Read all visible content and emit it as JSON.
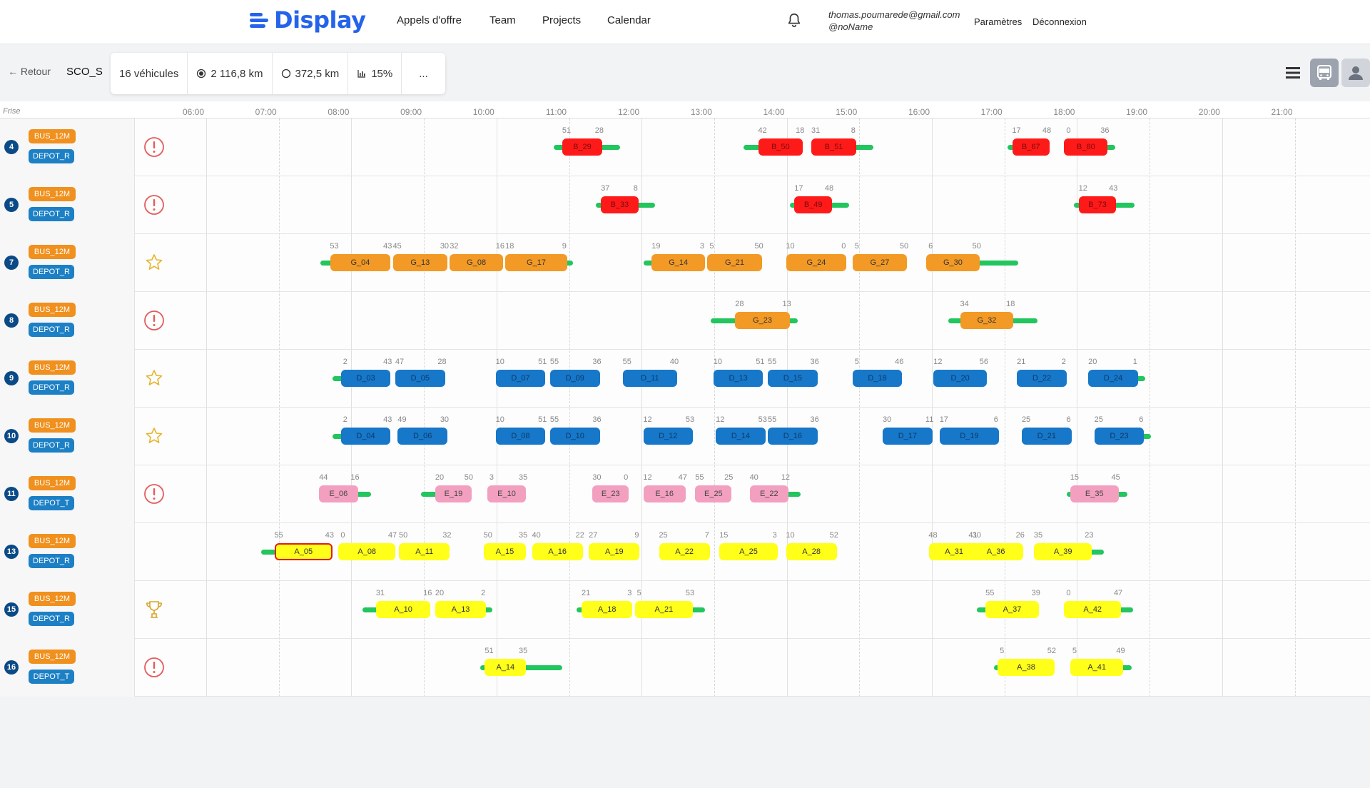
{
  "app": {
    "logo": "Display",
    "colors": {
      "brand": "#2563eb",
      "bus": "#f0901e",
      "depot": "#1d80c5",
      "green": "#22c55e",
      "vnum": "#0b4a86"
    }
  },
  "nav": {
    "links": [
      "Appels d'offre",
      "Team",
      "Projects",
      "Calendar"
    ],
    "user_email": "thomas.poumarede@gmail.com",
    "user_handle": "@noName",
    "settings": "Paramètres",
    "logout": "Déconnexion",
    "bell_icon": "bell-icon"
  },
  "toolbar": {
    "back": "← Retour",
    "line": "SCO_S",
    "vehicles": "16 véhicules",
    "km_loaded": "2 116,8 km",
    "km_empty": "372,5 km",
    "ratio": "15%",
    "more": "...",
    "view_icons": [
      "list-icon",
      "bus-icon",
      "person-icon"
    ]
  },
  "timeline": {
    "frise": "Frise",
    "hours": [
      "06:00",
      "07:00",
      "08:00",
      "09:00",
      "10:00",
      "11:00",
      "12:00",
      "13:00",
      "14:00",
      "15:00",
      "16:00",
      "17:00",
      "18:00",
      "19:00",
      "20:00",
      "21:00"
    ],
    "rows": [
      {
        "num": "4",
        "bus": "BUS_12M",
        "depot": "DEPOT_R",
        "status": "alert",
        "blocks": [
          {
            "label": "B_29",
            "c": "red",
            "s": "11:05",
            "e": "11:38",
            "n1": "51",
            "n2": "28",
            "pre": "10:58",
            "post": "11:53"
          },
          {
            "label": "B_50",
            "c": "red",
            "s": "13:47",
            "e": "14:24",
            "n1": "42",
            "n2": "18",
            "pre": "13:35",
            "post": null
          },
          {
            "label": "B_51",
            "c": "red",
            "s": "14:31",
            "e": "15:08",
            "n1": "31",
            "n2": "8",
            "pre": null,
            "post": "15:22"
          },
          {
            "label": "B_67",
            "c": "red",
            "s": "17:17",
            "e": "17:48",
            "n1": "17",
            "n2": "48",
            "pre": "17:13",
            "post": null
          },
          {
            "label": "B_80",
            "c": "red",
            "s": "18:00",
            "e": "18:36",
            "n1": "0",
            "n2": "36",
            "pre": null,
            "post": "18:42"
          }
        ]
      },
      {
        "num": "5",
        "bus": "BUS_12M",
        "depot": "DEPOT_R",
        "status": "alert",
        "blocks": [
          {
            "label": "B_33",
            "c": "red",
            "s": "11:37",
            "e": "12:08",
            "n1": "37",
            "n2": "8",
            "pre": "11:33",
            "post": "12:22"
          },
          {
            "label": "B_49",
            "c": "red",
            "s": "14:17",
            "e": "14:48",
            "n1": "17",
            "n2": "48",
            "pre": "14:13",
            "post": "15:02"
          },
          {
            "label": "B_73",
            "c": "red",
            "s": "18:12",
            "e": "18:43",
            "n1": "12",
            "n2": "43",
            "pre": "18:08",
            "post": "18:58"
          }
        ]
      },
      {
        "num": "7",
        "bus": "BUS_12M",
        "depot": "DEPOT_R",
        "status": "star",
        "blocks": [
          {
            "label": "G_04",
            "c": "orange",
            "s": "07:53",
            "e": "08:43",
            "n1": "53",
            "n2": "43",
            "pre": "07:45",
            "post": null
          },
          {
            "label": "G_13",
            "c": "orange",
            "s": "08:45",
            "e": "09:30",
            "n1": "45",
            "n2": "30",
            "pre": null,
            "post": null
          },
          {
            "label": "G_08",
            "c": "orange",
            "s": "09:32",
            "e": "10:16",
            "n1": "32",
            "n2": "16",
            "pre": null,
            "post": null
          },
          {
            "label": "G_17",
            "c": "orange",
            "s": "10:18",
            "e": "11:09",
            "n1": "18",
            "n2": "9",
            "pre": null,
            "post": "11:14"
          },
          {
            "label": "G_14",
            "c": "orange",
            "s": "12:19",
            "e": "13:03",
            "n1": "19",
            "n2": "3",
            "pre": "12:12",
            "post": null
          },
          {
            "label": "G_21",
            "c": "orange",
            "s": "13:05",
            "e": "13:50",
            "n1": "5",
            "n2": "50",
            "pre": null,
            "post": null
          },
          {
            "label": "G_24",
            "c": "orange",
            "s": "14:10",
            "e": "15:00",
            "n1": "10",
            "n2": "0",
            "pre": null,
            "post": null
          },
          {
            "label": "G_27",
            "c": "orange",
            "s": "15:05",
            "e": "15:50",
            "n1": "5",
            "n2": "50",
            "pre": null,
            "post": null
          },
          {
            "label": "G_30",
            "c": "orange",
            "s": "16:06",
            "e": "16:50",
            "n1": "6",
            "n2": "50",
            "pre": null,
            "post": "17:22"
          }
        ]
      },
      {
        "num": "8",
        "bus": "BUS_12M",
        "depot": "DEPOT_R",
        "status": "alert",
        "blocks": [
          {
            "label": "G_23",
            "c": "orange",
            "s": "13:28",
            "e": "14:13",
            "n1": "28",
            "n2": "13",
            "pre": "13:08",
            "post": "14:20"
          },
          {
            "label": "G_32",
            "c": "orange",
            "s": "16:34",
            "e": "17:18",
            "n1": "34",
            "n2": "18",
            "pre": "16:24",
            "post": "17:38"
          }
        ]
      },
      {
        "num": "9",
        "bus": "BUS_12M",
        "depot": "DEPOT_R",
        "status": "star",
        "blocks": [
          {
            "label": "D_03",
            "c": "blue",
            "s": "08:02",
            "e": "08:43",
            "n1": "2",
            "n2": "43",
            "pre": "07:55",
            "post": null
          },
          {
            "label": "D_05",
            "c": "blue",
            "s": "08:47",
            "e": "09:28",
            "n1": "47",
            "n2": "28",
            "pre": null,
            "post": null
          },
          {
            "label": "D_07",
            "c": "blue",
            "s": "10:10",
            "e": "10:51",
            "n1": "10",
            "n2": "51",
            "pre": null,
            "post": null
          },
          {
            "label": "D_09",
            "c": "blue",
            "s": "10:55",
            "e": "11:36",
            "n1": "55",
            "n2": "36",
            "pre": null,
            "post": null
          },
          {
            "label": "D_11",
            "c": "blue",
            "s": "11:55",
            "e": "12:40",
            "n1": "55",
            "n2": "40",
            "pre": null,
            "post": null
          },
          {
            "label": "D_13",
            "c": "blue",
            "s": "13:10",
            "e": "13:51",
            "n1": "10",
            "n2": "51",
            "pre": null,
            "post": null
          },
          {
            "label": "D_15",
            "c": "blue",
            "s": "13:55",
            "e": "14:36",
            "n1": "55",
            "n2": "36",
            "pre": null,
            "post": null
          },
          {
            "label": "D_18",
            "c": "blue",
            "s": "15:05",
            "e": "15:46",
            "n1": "5",
            "n2": "46",
            "pre": null,
            "post": null
          },
          {
            "label": "D_20",
            "c": "blue",
            "s": "16:12",
            "e": "16:56",
            "n1": "12",
            "n2": "56",
            "pre": null,
            "post": null
          },
          {
            "label": "D_22",
            "c": "blue",
            "s": "17:21",
            "e": "18:02",
            "n1": "21",
            "n2": "2",
            "pre": null,
            "post": null
          },
          {
            "label": "D_24",
            "c": "blue",
            "s": "18:20",
            "e": "19:01",
            "n1": "20",
            "n2": "1",
            "pre": null,
            "post": "19:07"
          }
        ]
      },
      {
        "num": "10",
        "bus": "BUS_12M",
        "depot": "DEPOT_R",
        "status": "star",
        "blocks": [
          {
            "label": "D_04",
            "c": "blue",
            "s": "08:02",
            "e": "08:43",
            "n1": "2",
            "n2": "43",
            "pre": "07:55",
            "post": null
          },
          {
            "label": "D_06",
            "c": "blue",
            "s": "08:49",
            "e": "09:30",
            "n1": "49",
            "n2": "30",
            "pre": null,
            "post": null
          },
          {
            "label": "D_08",
            "c": "blue",
            "s": "10:10",
            "e": "10:51",
            "n1": "10",
            "n2": "51",
            "pre": null,
            "post": null
          },
          {
            "label": "D_10",
            "c": "blue",
            "s": "10:55",
            "e": "11:36",
            "n1": "55",
            "n2": "36",
            "pre": null,
            "post": null
          },
          {
            "label": "D_12",
            "c": "blue",
            "s": "12:12",
            "e": "12:53",
            "n1": "12",
            "n2": "53",
            "pre": null,
            "post": null
          },
          {
            "label": "D_14",
            "c": "blue",
            "s": "13:12",
            "e": "13:53",
            "n1": "12",
            "n2": "53",
            "pre": null,
            "post": null
          },
          {
            "label": "D_16",
            "c": "blue",
            "s": "13:55",
            "e": "14:36",
            "n1": "55",
            "n2": "36",
            "pre": null,
            "post": null
          },
          {
            "label": "D_17",
            "c": "blue",
            "s": "15:30",
            "e": "16:11",
            "n1": "30",
            "n2": "11",
            "pre": null,
            "post": null
          },
          {
            "label": "D_19",
            "c": "blue",
            "s": "16:17",
            "e": "17:06",
            "n1": "17",
            "n2": "6",
            "pre": null,
            "post": null
          },
          {
            "label": "D_21",
            "c": "blue",
            "s": "17:25",
            "e": "18:06",
            "n1": "25",
            "n2": "6",
            "pre": null,
            "post": null
          },
          {
            "label": "D_23",
            "c": "blue",
            "s": "18:25",
            "e": "19:06",
            "n1": "25",
            "n2": "6",
            "pre": null,
            "post": "19:12"
          }
        ]
      },
      {
        "num": "11",
        "bus": "BUS_12M",
        "depot": "DEPOT_T",
        "status": "alert",
        "blocks": [
          {
            "label": "E_06",
            "c": "pink",
            "s": "07:44",
            "e": "08:16",
            "n1": "44",
            "n2": "16",
            "pre": null,
            "post": "08:27"
          },
          {
            "label": "E_19",
            "c": "pink",
            "s": "09:20",
            "e": "09:50",
            "n1": "20",
            "n2": "50",
            "pre": "09:08",
            "post": null
          },
          {
            "label": "E_10",
            "c": "pink",
            "s": "10:03",
            "e": "10:35",
            "n1": "3",
            "n2": "35",
            "pre": null,
            "post": null
          },
          {
            "label": "E_23",
            "c": "pink",
            "s": "11:30",
            "e": "12:00",
            "n1": "30",
            "n2": "0",
            "pre": null,
            "post": null
          },
          {
            "label": "E_16",
            "c": "pink",
            "s": "12:12",
            "e": "12:47",
            "n1": "12",
            "n2": "47",
            "pre": null,
            "post": null
          },
          {
            "label": "E_25",
            "c": "pink",
            "s": "12:55",
            "e": "13:25",
            "n1": "55",
            "n2": "25",
            "pre": null,
            "post": null
          },
          {
            "label": "E_22",
            "c": "pink",
            "s": "13:40",
            "e": "14:12",
            "n1": "40",
            "n2": "12",
            "pre": null,
            "post": "14:22"
          },
          {
            "label": "E_35",
            "c": "pink",
            "s": "18:05",
            "e": "18:45",
            "n1": "15",
            "n2": "45",
            "pre": "18:02",
            "post": "18:52"
          }
        ]
      },
      {
        "num": "13",
        "bus": "BUS_12M",
        "depot": "DEPOT_R",
        "status": "none",
        "blocks": [
          {
            "label": "A_05",
            "c": "yellow-outline",
            "s": "07:07",
            "e": "07:55",
            "n1": "55",
            "n2": "43",
            "pre": "06:56",
            "post": null
          },
          {
            "label": "A_08",
            "c": "yellow",
            "s": "08:00",
            "e": "08:47",
            "n1": "0",
            "n2": "47",
            "pre": null,
            "post": null
          },
          {
            "label": "A_11",
            "c": "yellow",
            "s": "08:50",
            "e": "09:32",
            "n1": "50",
            "n2": "32",
            "pre": null,
            "post": null
          },
          {
            "label": "A_15",
            "c": "yellow",
            "s": "10:00",
            "e": "10:35",
            "n1": "50",
            "n2": "35",
            "pre": null,
            "post": null
          },
          {
            "label": "A_16",
            "c": "yellow",
            "s": "10:40",
            "e": "11:22",
            "n1": "40",
            "n2": "22",
            "pre": null,
            "post": null
          },
          {
            "label": "A_19",
            "c": "yellow",
            "s": "11:27",
            "e": "12:09",
            "n1": "27",
            "n2": "9",
            "pre": null,
            "post": null
          },
          {
            "label": "A_22",
            "c": "yellow",
            "s": "12:25",
            "e": "13:07",
            "n1": "25",
            "n2": "7",
            "pre": null,
            "post": null
          },
          {
            "label": "A_25",
            "c": "yellow",
            "s": "13:15",
            "e": "14:03",
            "n1": "15",
            "n2": "3",
            "pre": null,
            "post": null
          },
          {
            "label": "A_28",
            "c": "yellow",
            "s": "14:10",
            "e": "14:52",
            "n1": "10",
            "n2": "52",
            "pre": null,
            "post": null
          },
          {
            "label": "A_31",
            "c": "yellow",
            "s": "16:08",
            "e": "16:50",
            "n1": "48",
            "n2": "30",
            "pre": null,
            "post": null
          },
          {
            "label": "A_36",
            "c": "yellow",
            "s": "16:41",
            "e": "17:26",
            "n1": "41",
            "n2": "26",
            "pre": null,
            "post": null
          },
          {
            "label": "A_39",
            "c": "yellow",
            "s": "17:35",
            "e": "18:23",
            "n1": "35",
            "n2": "23",
            "pre": null,
            "post": "18:33"
          }
        ]
      },
      {
        "num": "15",
        "bus": "BUS_12M",
        "depot": "DEPOT_R",
        "status": "trophy",
        "blocks": [
          {
            "label": "A_10",
            "c": "yellow",
            "s": "08:31",
            "e": "09:16",
            "n1": "31",
            "n2": "16",
            "pre": "08:20",
            "post": null
          },
          {
            "label": "A_13",
            "c": "yellow",
            "s": "09:20",
            "e": "10:02",
            "n1": "20",
            "n2": "2",
            "pre": null,
            "post": "10:07"
          },
          {
            "label": "A_18",
            "c": "yellow",
            "s": "11:21",
            "e": "12:03",
            "n1": "21",
            "n2": "3",
            "pre": "11:17",
            "post": null
          },
          {
            "label": "A_21",
            "c": "yellow",
            "s": "12:05",
            "e": "12:53",
            "n1": "5",
            "n2": "53",
            "pre": null,
            "post": "13:03"
          },
          {
            "label": "A_37",
            "c": "yellow",
            "s": "16:55",
            "e": "17:39",
            "n1": "55",
            "n2": "39",
            "pre": "16:48",
            "post": null
          },
          {
            "label": "A_42",
            "c": "yellow",
            "s": "18:00",
            "e": "18:47",
            "n1": "0",
            "n2": "47",
            "pre": null,
            "post": "18:57"
          }
        ]
      },
      {
        "num": "16",
        "bus": "BUS_12M",
        "depot": "DEPOT_T",
        "status": "alert",
        "blocks": [
          {
            "label": "A_14",
            "c": "yellow",
            "s": "10:01",
            "e": "10:35",
            "n1": "51",
            "n2": "35",
            "pre": "09:57",
            "post": "11:05"
          },
          {
            "label": "A_38",
            "c": "yellow",
            "s": "17:05",
            "e": "17:52",
            "n1": "5",
            "n2": "52",
            "pre": "17:02",
            "post": null
          },
          {
            "label": "A_41",
            "c": "yellow",
            "s": "18:05",
            "e": "18:49",
            "n1": "5",
            "n2": "49",
            "pre": null,
            "post": "18:56"
          }
        ]
      }
    ]
  }
}
